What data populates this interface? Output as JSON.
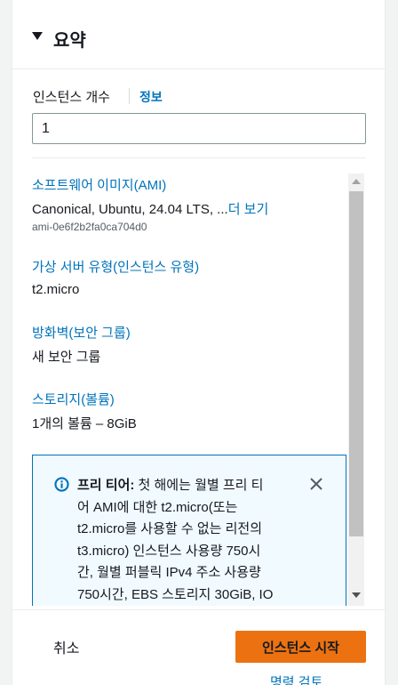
{
  "summary": {
    "title": "요약"
  },
  "instance_count": {
    "label": "인스턴스 개수",
    "info_link": "정보",
    "value": "1"
  },
  "sections": {
    "ami": {
      "link": "소프트웨어 이미지(AMI)",
      "value": "Canonical, Ubuntu, 24.04 LTS, ...",
      "more": "더 보기",
      "id": "ami-0e6f2b2fa0ca704d0"
    },
    "instance_type": {
      "link": "가상 서버 유형(인스턴스 유형)",
      "value": "t2.micro"
    },
    "firewall": {
      "link": "방화벽(보안 그룹)",
      "value": "새 보안 그룹"
    },
    "storage": {
      "link": "스토리지(볼륨)",
      "value": "1개의 볼륨 – 8GiB"
    }
  },
  "free_tier_alert": {
    "title": "프리 티어:",
    "line1": " 첫 해에는 월별 프리 티",
    "line2": "어 AMI에 대한 t2.micro(또는",
    "line3": "t2.micro를 사용할 수 없는 리전의",
    "line4": "t3.micro) 인스턴스 사용량 750시",
    "line5": "간, 월별 퍼블릭 IPv4 주소 사용량",
    "line6": "750시간, EBS 스토리지 30GiB, IO"
  },
  "footer": {
    "cancel": "취소",
    "launch": "인스턴스 시작",
    "review": "명령 검토"
  },
  "colors": {
    "link": "#0073bb",
    "primary_button": "#ec7211",
    "alert_bg": "#f1faff",
    "alert_border": "#0073bb"
  },
  "icons": [
    "caret-down-icon",
    "info-icon",
    "close-icon"
  ]
}
